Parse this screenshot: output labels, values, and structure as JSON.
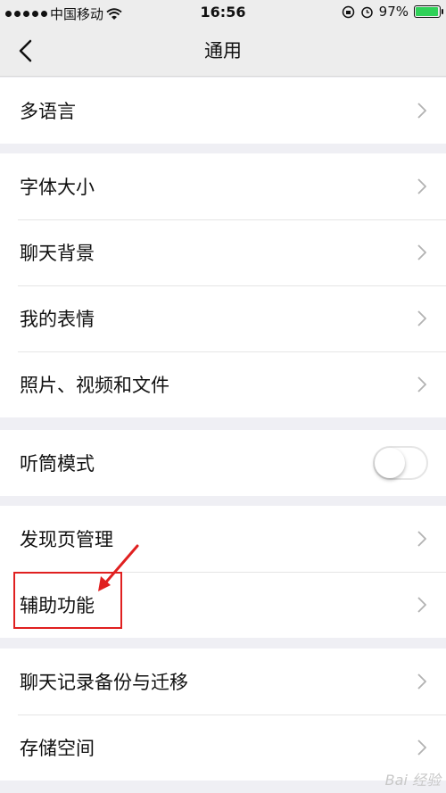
{
  "status_bar": {
    "carrier": "中国移动",
    "time": "16:56",
    "battery_percent": "97%",
    "battery_color": "#2fd158"
  },
  "nav": {
    "title": "通用",
    "back_icon": "chevron-left-icon"
  },
  "groups": {
    "language": {
      "label": "多语言"
    },
    "display": {
      "font_size": "字体大小",
      "chat_background": "聊天背景",
      "stickers": "我的表情",
      "media": "照片、视频和文件"
    },
    "earpiece": {
      "label": "听筒模式",
      "enabled": false
    },
    "discover": {
      "discover_mgmt": "发现页管理",
      "accessibility": "辅助功能"
    },
    "storage": {
      "chat_backup": "聊天记录备份与迁移",
      "storage_space": "存储空间"
    }
  },
  "annotation": {
    "highlight_color": "#e02020"
  },
  "watermark": "Bai 经验"
}
